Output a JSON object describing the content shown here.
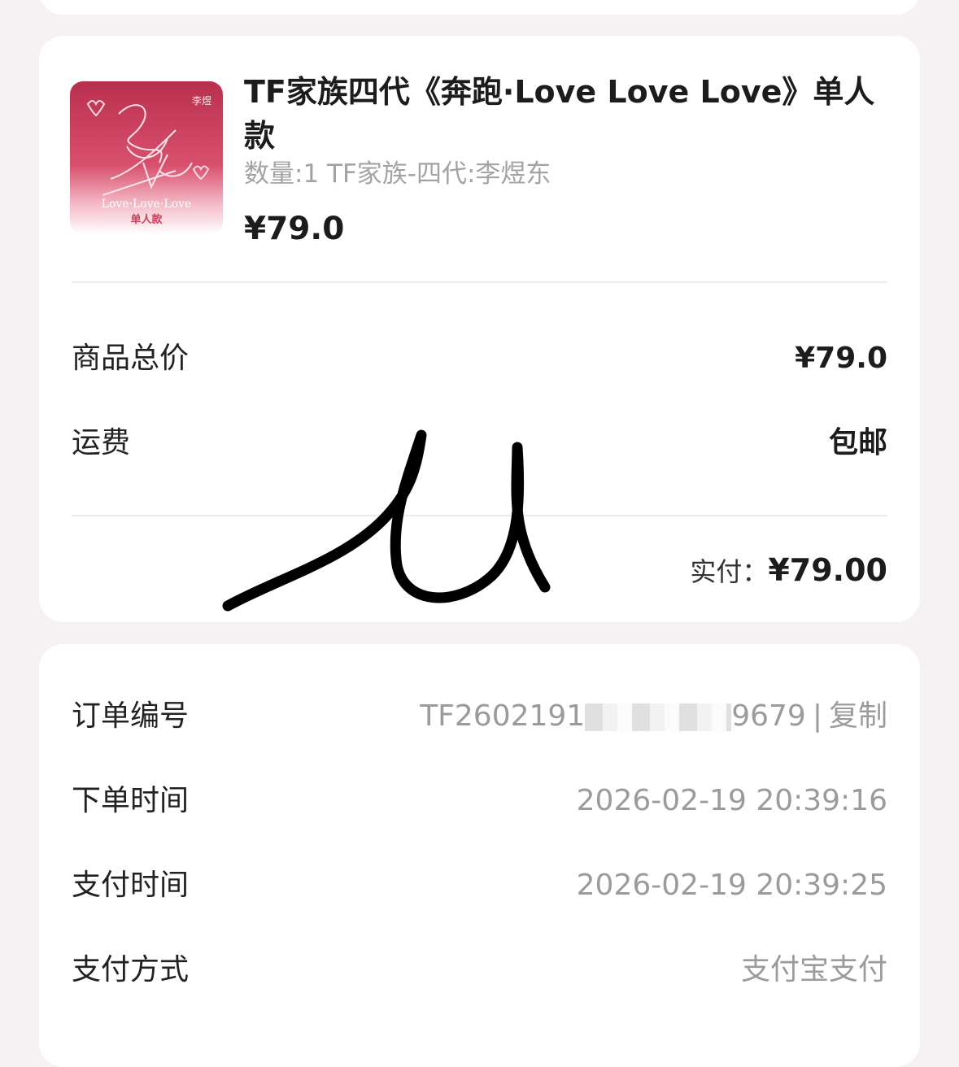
{
  "product": {
    "title": "TF家族四代《奔跑·Love Love Love》单人款",
    "spec": "数量:1 TF家族-四代:李煜东",
    "price": "¥79.0",
    "thumbnail_label": "单人款",
    "thumbnail_caption": "Love·Love·Love"
  },
  "summary": {
    "goods_total_label": "商品总价",
    "goods_total_value": "¥79.0",
    "shipping_label": "运费",
    "shipping_value": "包邮",
    "paid_label": "实付：",
    "paid_value": "¥79.00"
  },
  "order_info": {
    "order_no_label": "订单编号",
    "order_no_prefix": "TF2602191",
    "order_no_suffix": "9679",
    "copy_label": "复制",
    "separator": "|",
    "order_time_label": "下单时间",
    "order_time_value": "2026-02-19 20:39:16",
    "pay_time_label": "支付时间",
    "pay_time_value": "2026-02-19 20:39:25",
    "pay_method_label": "支付方式",
    "pay_method_value": "支付宝支付"
  },
  "colors": {
    "page_bg": "#f6f1f3",
    "card_bg": "#ffffff",
    "muted_text": "#9b9b9b",
    "thumbnail_pink": "#c9405e"
  },
  "annotation": {
    "handwritten_mark": "u"
  }
}
